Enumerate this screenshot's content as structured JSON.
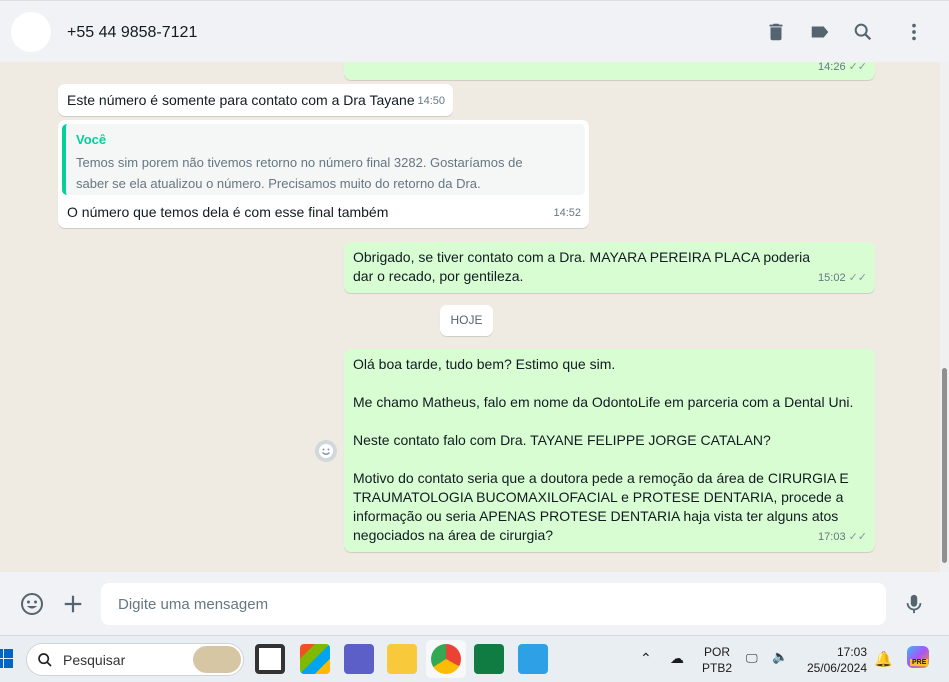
{
  "header": {
    "contact": "+55 44 9858-7121",
    "icons": [
      "delete-icon",
      "label-icon",
      "search-icon",
      "menu-icon"
    ]
  },
  "messages": [
    {
      "dir": "out",
      "text": "",
      "time": "14:26",
      "status": "read"
    },
    {
      "dir": "in",
      "text": "Este número é somente para contato com a Dra Tayane",
      "time": "14:50"
    },
    {
      "dir": "in",
      "quote_author": "Você",
      "quote_text": "Temos sim porem não tivemos retorno no número final 3282. Gostaríamos de saber se ela atualizou o número. Precisamos muito do retorno da Dra.",
      "text": "O número que temos dela é com esse final também",
      "time": "14:52"
    },
    {
      "dir": "out",
      "text": "Obrigado, se tiver contato com a Dra. MAYARA PEREIRA PLACA poderia dar o recado, por gentileza.",
      "time": "15:02",
      "status": "read"
    },
    {
      "dir": "out",
      "lines": [
        "Olá boa tarde, tudo bem? Estimo que sim.",
        "Me chamo Matheus, falo em nome da OdontoLife em parceria com a Dental Uni.",
        "Neste contato falo com Dra. TAYANE FELIPPE JORGE CATALAN?",
        "Motivo do contato seria que a doutora pede a remoção da área de CIRURGIA E TRAUMATOLOGIA BUCOMAXILOFACIAL e PROTESE DENTARIA, procede a informação ou seria APENAS PROTESE DENTARIA haja vista ter alguns atos negociados na área de cirurgia?"
      ],
      "time": "17:03",
      "status": "read"
    }
  ],
  "date_divider": "HOJE",
  "composer": {
    "placeholder": "Digite uma mensagem"
  },
  "taskbar": {
    "search": "Pesquisar",
    "lang1": "POR",
    "lang2": "PTB2",
    "time": "17:03",
    "date": "25/06/2024",
    "copilot_badge": "PRE"
  },
  "colors": {
    "outgoing": "#d9fdd3",
    "incoming": "#ffffff",
    "accent": "#06cf9c",
    "background": "#efeae2"
  }
}
